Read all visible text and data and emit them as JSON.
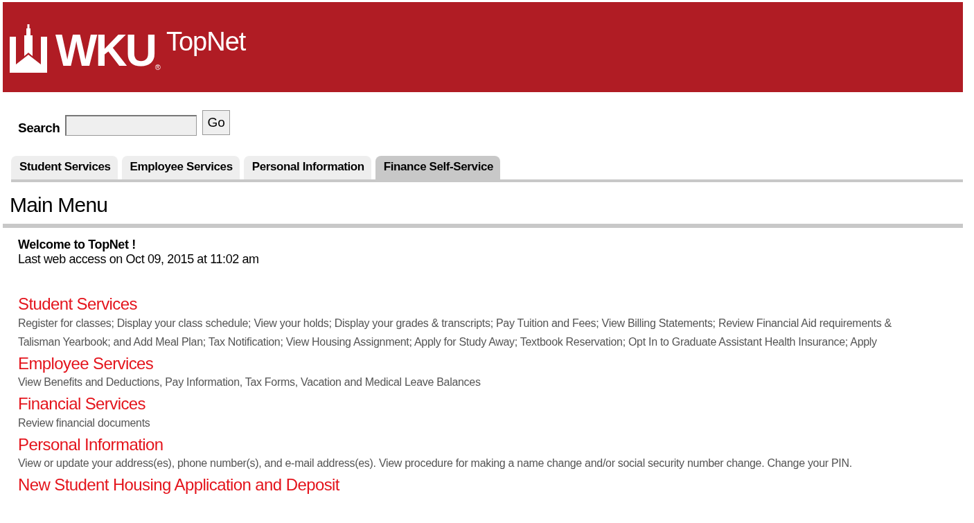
{
  "header": {
    "logo_text": "WKU",
    "registered_mark": "®",
    "app_name": "TopNet"
  },
  "search": {
    "label": "Search",
    "button": "Go"
  },
  "tabs": [
    {
      "label": "Student Services",
      "selected": false
    },
    {
      "label": "Employee Services",
      "selected": false
    },
    {
      "label": "Personal Information",
      "selected": false
    },
    {
      "label": "Finance Self-Service",
      "selected": true
    }
  ],
  "page_title": "Main Menu",
  "welcome": {
    "title": "Welcome to TopNet !",
    "last_access": "Last web access on Oct 09, 2015 at 11:02 am"
  },
  "menu": [
    {
      "title": "Student Services",
      "description": [
        "Register for classes; Display your class schedule; View your holds; Display your grades & transcripts; Pay Tuition and Fees; View Billing Statements; Review Financial Aid requirements &",
        "Talisman Yearbook; and Add Meal Plan; Tax Notification; View Housing Assignment; Apply for Study Away; Textbook Reservation; Opt In to Graduate Assistant Health Insurance; Apply"
      ]
    },
    {
      "title": "Employee Services",
      "description": [
        "View Benefits and Deductions, Pay Information, Tax Forms, Vacation and Medical Leave Balances"
      ]
    },
    {
      "title": "Financial Services",
      "description": [
        "Review financial documents"
      ]
    },
    {
      "title": "Personal Information",
      "description": [
        "View or update your address(es), phone number(s), and e-mail address(es). View procedure for making a name change and/or social security number change. Change your PIN."
      ]
    },
    {
      "title": "New Student Housing Application and Deposit"
    }
  ]
}
